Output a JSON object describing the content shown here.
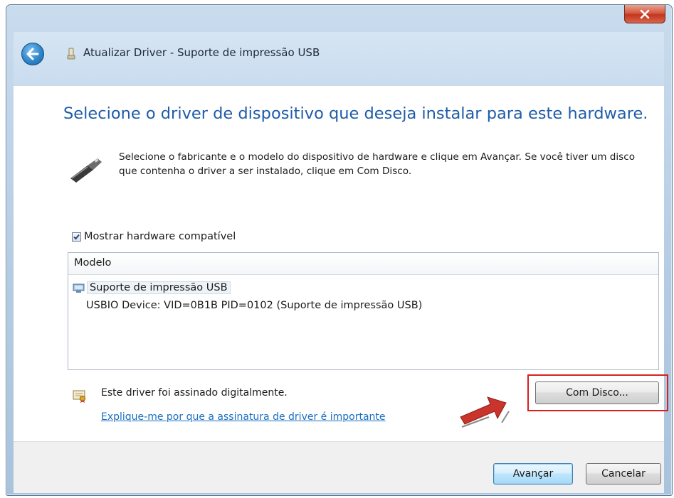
{
  "window": {
    "title": "Atualizar Driver - Suporte de impressão USB"
  },
  "icons": {
    "close": "close-icon",
    "back": "back-arrow-icon",
    "title": "device-icon",
    "usb": "usb-connector-icon",
    "manufacturer": "printer-device-icon",
    "signed": "signed-driver-icon",
    "annotation": "red-arrow-icon"
  },
  "main": {
    "heading": "Selecione o driver de dispositivo que deseja instalar para este hardware.",
    "description": "Selecione o fabricante e o modelo do dispositivo de hardware e clique em Avançar. Se você tiver um disco que contenha o driver a ser instalado, clique em Com Disco.",
    "show_compatible_label": "Mostrar hardware compatível",
    "show_compatible_checked": true
  },
  "list": {
    "header": "Modelo",
    "manufacturer": "Suporte de impressão USB",
    "model": "USBIO Device: VID=0B1B PID=0102 (Suporte de impressão USB)"
  },
  "signature": {
    "text": "Este driver foi assinado digitalmente.",
    "link": "Explique-me por que a assinatura de driver é importante"
  },
  "buttons": {
    "have_disk": "Com Disco...",
    "next": "Avançar",
    "cancel": "Cancelar"
  },
  "colors": {
    "heading": "#1f5ca8",
    "link": "#1a6fc0",
    "highlight": "#d91f1f",
    "arrow": "#c9342c"
  }
}
